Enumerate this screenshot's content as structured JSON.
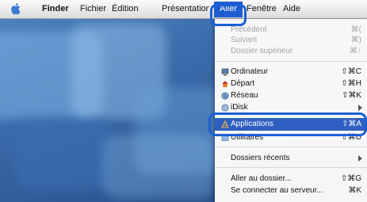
{
  "menubar": {
    "apple": "apple-logo",
    "items": [
      "Finder",
      "Fichier",
      "Édition",
      "Présentation",
      "Aller",
      "Fenêtre",
      "Aide"
    ]
  },
  "menu": {
    "items": [
      {
        "label": "Précédent",
        "shortcut": "⌘(",
        "enabled": false
      },
      {
        "label": "Suivant",
        "shortcut": "⌘)",
        "enabled": false
      },
      {
        "label": "Dossier supérieur",
        "shortcut": "⌘↑",
        "enabled": false
      },
      {
        "label": "Ordinateur",
        "shortcut": "⇧⌘C",
        "icon": "computer-icon"
      },
      {
        "label": "Départ",
        "shortcut": "⇧⌘H",
        "icon": "home-icon"
      },
      {
        "label": "Réseau",
        "shortcut": "⇧⌘K",
        "icon": "network-icon"
      },
      {
        "label": "iDisk",
        "icon": "idisk-icon",
        "submenu": true
      },
      {
        "label": "Applications",
        "shortcut": "⇧⌘A",
        "icon": "applications-icon",
        "selected": true
      },
      {
        "label": "Utilitaires",
        "shortcut": "⇧⌘U",
        "icon": "utilities-icon"
      },
      {
        "label": "Dossiers récents",
        "submenu": true
      },
      {
        "label": "Aller au dossier...",
        "shortcut": "⇧⌘G"
      },
      {
        "label": "Se connecter au serveur...",
        "shortcut": "⌘K"
      }
    ]
  },
  "colors": {
    "selection": "#2e5fc1",
    "highlight_ring": "#1c5fd6",
    "menu_highlight": "#1f5ccf"
  }
}
